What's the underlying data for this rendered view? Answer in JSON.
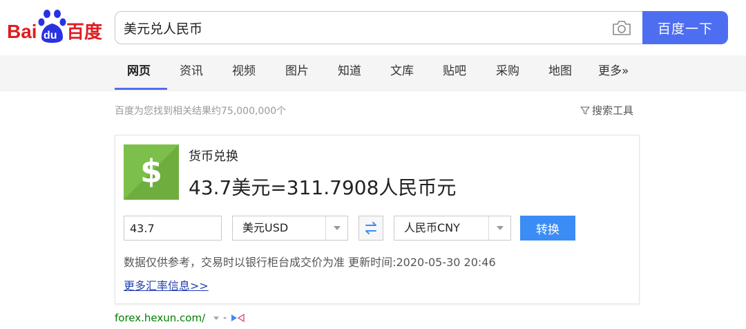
{
  "logo": {
    "text_bai": "Bai",
    "text_du": "du",
    "text_cn": "百度"
  },
  "search": {
    "query": "美元兑人民币",
    "button_label": "百度一下"
  },
  "nav": {
    "tabs": [
      {
        "label": "网页",
        "active": true
      },
      {
        "label": "资讯"
      },
      {
        "label": "视频"
      },
      {
        "label": "图片"
      },
      {
        "label": "知道"
      },
      {
        "label": "文库"
      },
      {
        "label": "贴吧"
      },
      {
        "label": "采购"
      },
      {
        "label": "地图"
      },
      {
        "label": "更多»"
      }
    ]
  },
  "results": {
    "count_text": "百度为您找到相关结果约75,000,000个",
    "tools_label": "搜索工具"
  },
  "converter": {
    "title": "货币兑换",
    "result_text": "43.7美元=311.7908人民币元",
    "amount": "43.7",
    "from_currency": "美元USD",
    "to_currency": "人民币CNY",
    "convert_label": "转换",
    "disclaimer": "数据仅供参考，交易时以银行柜台成交价为准 更新时间:2020-05-30 20:46",
    "more_link": "更多汇率信息>>"
  },
  "source": {
    "url": "forex.hexun.com/",
    "dash": "-"
  },
  "colors": {
    "accent": "#4e6ef2",
    "logo_red": "#de1d23",
    "logo_blue": "#2932e1",
    "link": "#2440b3",
    "green_url": "#008000",
    "dollar_green": "#7cbf4a"
  }
}
